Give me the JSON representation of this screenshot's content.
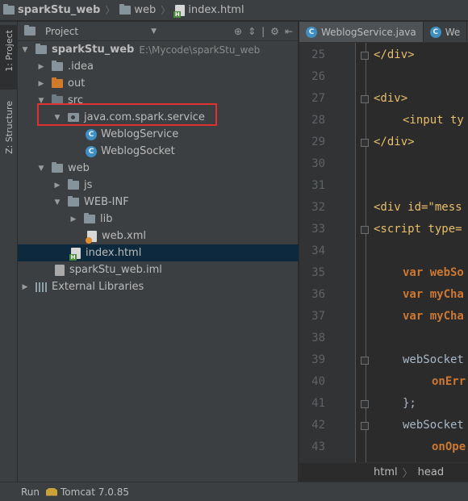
{
  "breadcrumb": {
    "project": "sparkStu_web",
    "folder": "web",
    "file": "index.html"
  },
  "left_toolwindows": {
    "project_tab": "1: Project",
    "structure_tab": "Z: Structure"
  },
  "project_panel": {
    "title": "Project",
    "tree": [
      {
        "label": "sparkStu_web",
        "extra": "E:\\Mycode\\sparkStu_web"
      },
      {
        "label": ".idea"
      },
      {
        "label": "out"
      },
      {
        "label": "src"
      },
      {
        "label": "java.com.spark.service"
      },
      {
        "label": "WeblogService"
      },
      {
        "label": "WeblogSocket"
      },
      {
        "label": "web"
      },
      {
        "label": "js"
      },
      {
        "label": "WEB-INF"
      },
      {
        "label": "lib"
      },
      {
        "label": "web.xml"
      },
      {
        "label": "index.html"
      },
      {
        "label": "sparkStu_web.iml"
      },
      {
        "label": "External Libraries"
      }
    ]
  },
  "editor": {
    "tabs": [
      "WeblogService.java",
      "We"
    ],
    "line_numbers": [
      "25",
      "26",
      "27",
      "28",
      "29",
      "30",
      "31",
      "32",
      "33",
      "34",
      "35",
      "36",
      "37",
      "38",
      "39",
      "40",
      "41",
      "42",
      "43"
    ],
    "code_lines": [
      "</div>",
      "",
      "<div>",
      "<input ty",
      "</div>",
      "",
      "",
      "<div id=\"mess",
      "<script type=",
      "",
      "var webSo",
      "var myCha",
      "var myCha",
      "",
      "webSocket",
      "onErr",
      "};",
      "webSocket",
      "onOpe"
    ],
    "bottom_crumbs": {
      "tag1": "html",
      "tag2": "head"
    }
  },
  "status_bar": {
    "run_label": "Run",
    "config": "Tomcat 7.0.85"
  },
  "colors": {
    "highlight_box": "#e03030",
    "selection": "#0d293e",
    "tag": "#e8bf6a",
    "keyword": "#cc7832",
    "string": "#6a8759"
  }
}
